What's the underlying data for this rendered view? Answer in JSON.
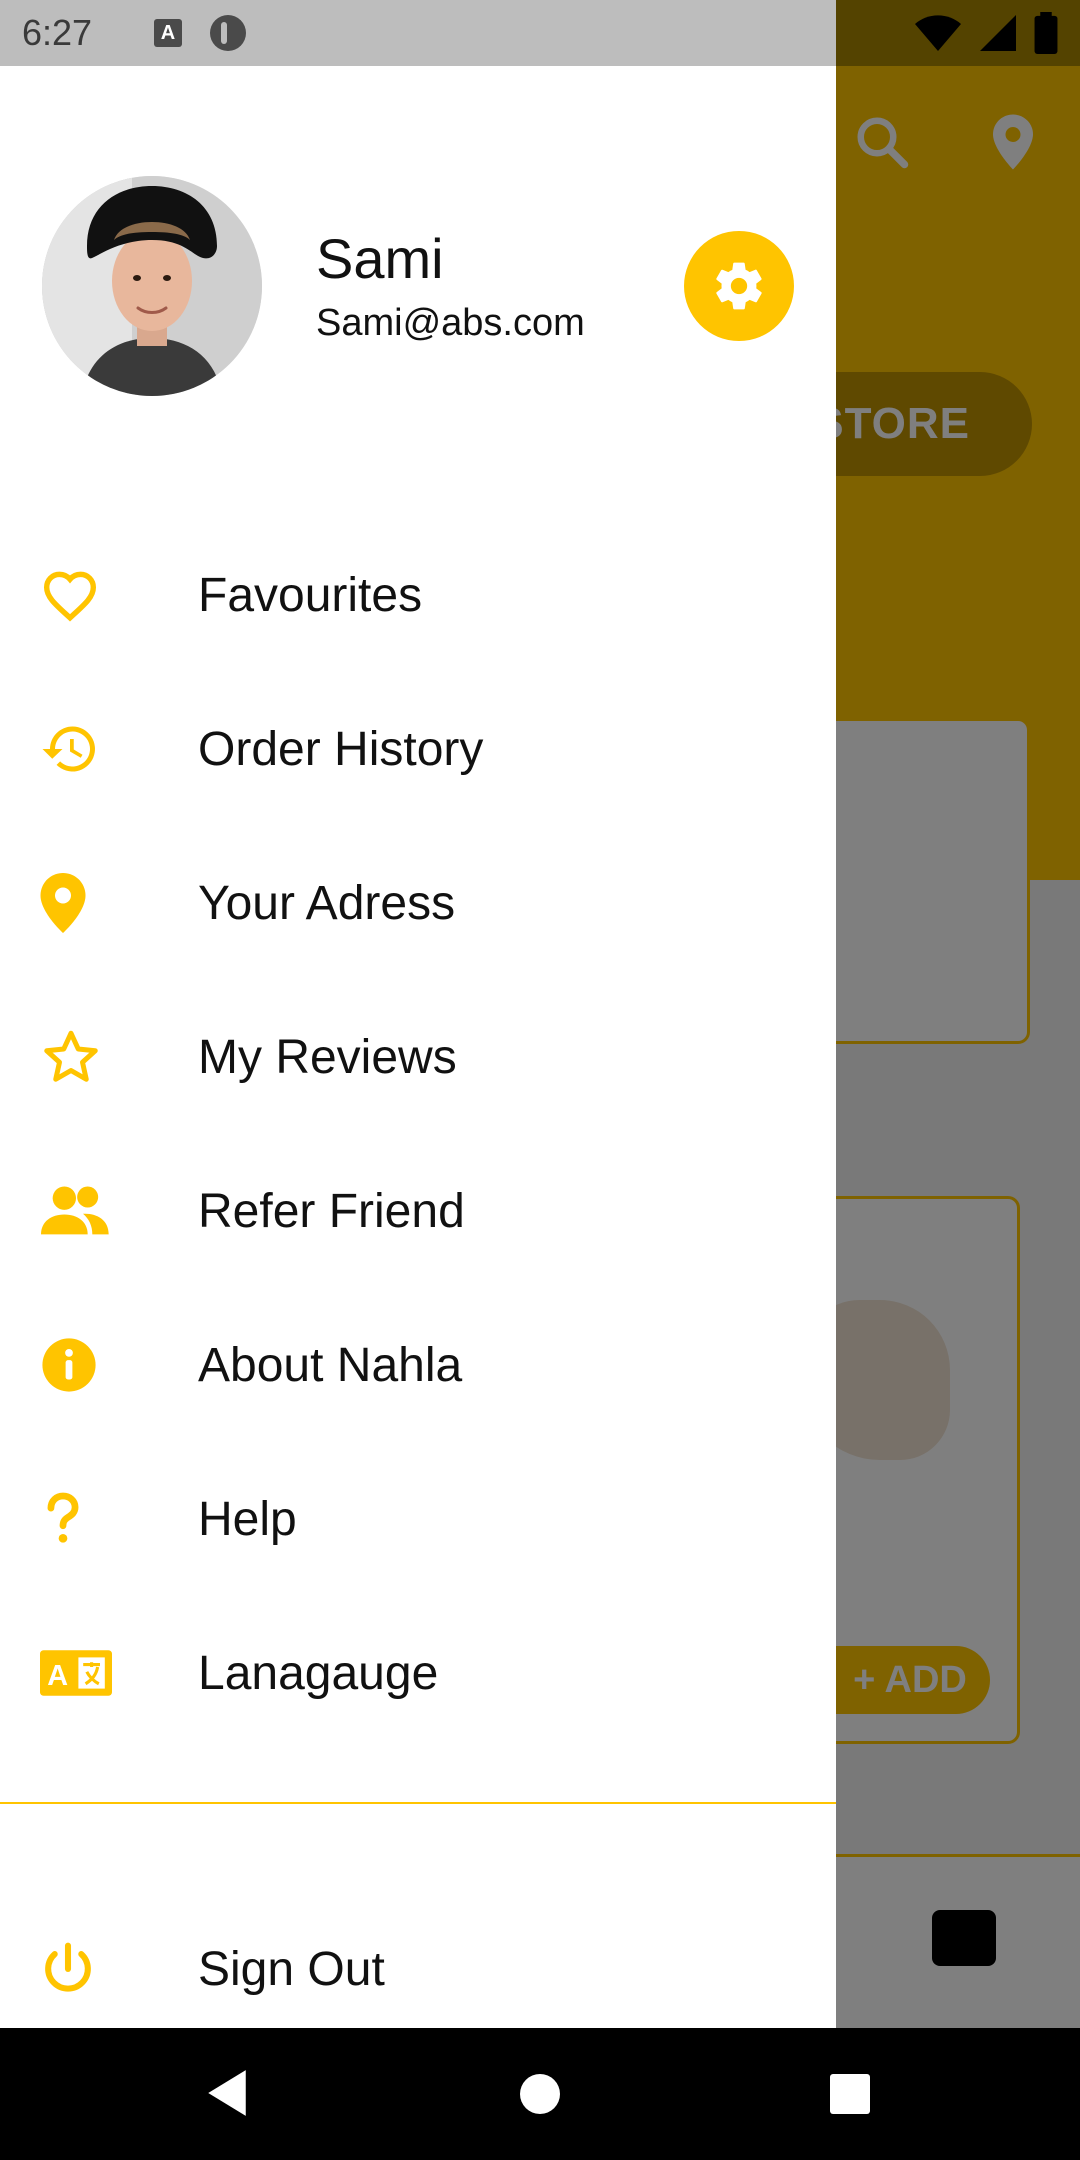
{
  "status_bar": {
    "time": "6:27",
    "notification_icons": [
      "a-keyboard-icon",
      "p-app-icon"
    ],
    "system_icons": [
      "wifi-icon",
      "signal-icon",
      "battery-icon"
    ]
  },
  "drawer": {
    "profile": {
      "name": "Sami",
      "email": "Sami@abs.com",
      "settings_icon": "gear-icon"
    },
    "menu_items": [
      {
        "label": "Favourites",
        "icon": "heart-icon"
      },
      {
        "label": "Order History",
        "icon": "history-icon"
      },
      {
        "label": "Your Adress",
        "icon": "location-pin-icon"
      },
      {
        "label": "My Reviews",
        "icon": "star-icon"
      },
      {
        "label": "Refer Friend",
        "icon": "people-icon"
      },
      {
        "label": "About Nahla",
        "icon": "info-icon"
      },
      {
        "label": "Help",
        "icon": "question-icon"
      },
      {
        "label": "Lanagauge",
        "icon": "language-icon"
      }
    ],
    "sign_out": {
      "label": "Sign Out",
      "icon": "power-icon"
    }
  },
  "background_app": {
    "store_button": "STORE",
    "add_button": "+ ADD"
  },
  "colors": {
    "accent": "#FFC400",
    "text": "#111111"
  }
}
